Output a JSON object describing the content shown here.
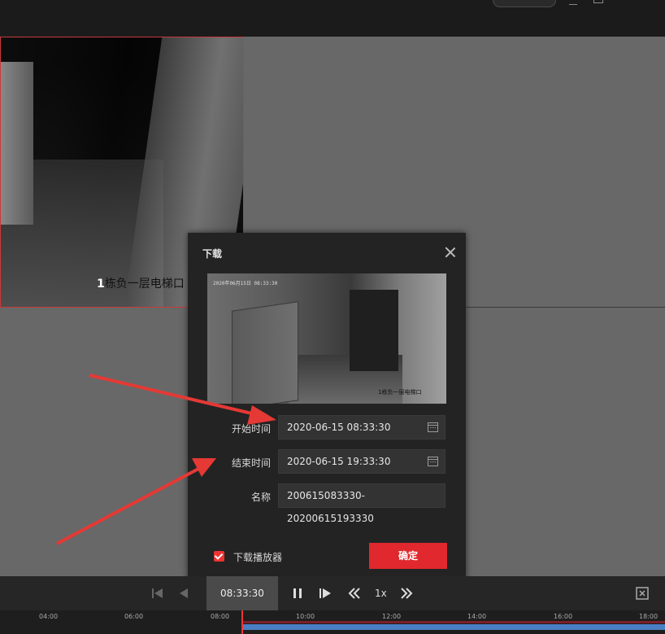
{
  "dialog": {
    "title": "下载",
    "start_label": "开始时间",
    "start_value": "2020-06-15 08:33:30",
    "end_label": "结束时间",
    "end_value": "2020-06-15 19:33:30",
    "name_label": "名称",
    "name_value": "200615083330-20200615193330",
    "checkbox_label": "下载播放器",
    "checkbox_checked": true,
    "confirm_label": "确定"
  },
  "camera_tile": {
    "label_num": "1",
    "label_text": "栋负一层电梯口"
  },
  "preview": {
    "stamp": "2020年06月15日 08:33:30",
    "label": "1栋负一层电梯口"
  },
  "playback": {
    "current_time": "08:33:30",
    "speed": "1x"
  },
  "timeline": {
    "ticks": [
      "04:00",
      "06:00",
      "08:00",
      "10:00",
      "12:00",
      "14:00",
      "16:00",
      "18:00"
    ]
  },
  "colors": {
    "accent": "#e0282e",
    "record_segment": "#4a7ec3",
    "selection_border": "#c93a3a"
  }
}
